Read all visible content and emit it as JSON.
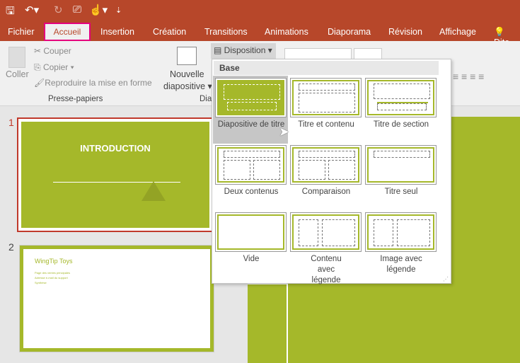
{
  "quick_access": {
    "save_icon": "save-icon",
    "undo_icon": "undo-icon",
    "redo_icon": "redo-icon",
    "present_icon": "present-icon",
    "touch_icon": "touch-mode-icon"
  },
  "tabs": [
    "Fichier",
    "Accueil",
    "Insertion",
    "Création",
    "Transitions",
    "Animations",
    "Diaporama",
    "Révision",
    "Affichage",
    "Dite"
  ],
  "active_tab": "Accueil",
  "ribbon": {
    "paste": "Coller",
    "cut": "Couper",
    "copy": "Copier",
    "format_painter": "Reproduire la mise en forme",
    "clipboard_group": "Presse-papiers",
    "new_slide_1": "Nouvelle",
    "new_slide_2": "diapositive",
    "slides_group": "Dia",
    "layout": "Disposition"
  },
  "layout_menu": {
    "header": "Base",
    "items": [
      "Diapositive de titre",
      "Titre et contenu",
      "Titre de section",
      "Deux contenus",
      "Comparaison",
      "Titre seul",
      "Vide",
      "Contenu avec légende",
      "Image avec légende"
    ]
  },
  "slides": [
    {
      "number": "1",
      "title": "INTRODUCTION"
    },
    {
      "number": "2",
      "title": "WingTip Toys",
      "bullets": [
        "Page des ventes principales",
        "Adresse e-mail du support",
        "Synthèse"
      ]
    }
  ],
  "colors": {
    "accent": "#b7472a",
    "theme_green": "#a5b82a",
    "highlight": "#e5007e"
  }
}
